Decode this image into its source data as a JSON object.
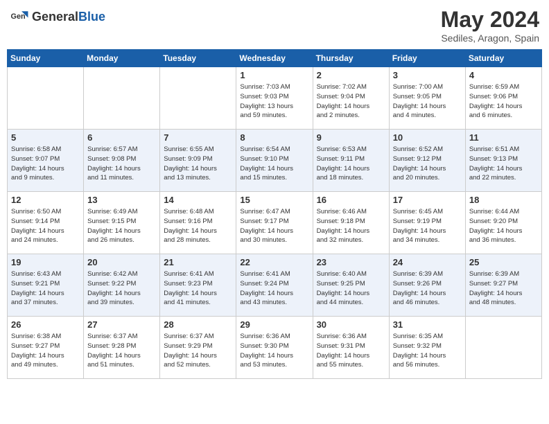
{
  "header": {
    "logo_general": "General",
    "logo_blue": "Blue",
    "month_year": "May 2024",
    "location": "Sediles, Aragon, Spain"
  },
  "days_of_week": [
    "Sunday",
    "Monday",
    "Tuesday",
    "Wednesday",
    "Thursday",
    "Friday",
    "Saturday"
  ],
  "weeks": [
    [
      {
        "day": "",
        "info": ""
      },
      {
        "day": "",
        "info": ""
      },
      {
        "day": "",
        "info": ""
      },
      {
        "day": "1",
        "info": "Sunrise: 7:03 AM\nSunset: 9:03 PM\nDaylight: 13 hours\nand 59 minutes."
      },
      {
        "day": "2",
        "info": "Sunrise: 7:02 AM\nSunset: 9:04 PM\nDaylight: 14 hours\nand 2 minutes."
      },
      {
        "day": "3",
        "info": "Sunrise: 7:00 AM\nSunset: 9:05 PM\nDaylight: 14 hours\nand 4 minutes."
      },
      {
        "day": "4",
        "info": "Sunrise: 6:59 AM\nSunset: 9:06 PM\nDaylight: 14 hours\nand 6 minutes."
      }
    ],
    [
      {
        "day": "5",
        "info": "Sunrise: 6:58 AM\nSunset: 9:07 PM\nDaylight: 14 hours\nand 9 minutes."
      },
      {
        "day": "6",
        "info": "Sunrise: 6:57 AM\nSunset: 9:08 PM\nDaylight: 14 hours\nand 11 minutes."
      },
      {
        "day": "7",
        "info": "Sunrise: 6:55 AM\nSunset: 9:09 PM\nDaylight: 14 hours\nand 13 minutes."
      },
      {
        "day": "8",
        "info": "Sunrise: 6:54 AM\nSunset: 9:10 PM\nDaylight: 14 hours\nand 15 minutes."
      },
      {
        "day": "9",
        "info": "Sunrise: 6:53 AM\nSunset: 9:11 PM\nDaylight: 14 hours\nand 18 minutes."
      },
      {
        "day": "10",
        "info": "Sunrise: 6:52 AM\nSunset: 9:12 PM\nDaylight: 14 hours\nand 20 minutes."
      },
      {
        "day": "11",
        "info": "Sunrise: 6:51 AM\nSunset: 9:13 PM\nDaylight: 14 hours\nand 22 minutes."
      }
    ],
    [
      {
        "day": "12",
        "info": "Sunrise: 6:50 AM\nSunset: 9:14 PM\nDaylight: 14 hours\nand 24 minutes."
      },
      {
        "day": "13",
        "info": "Sunrise: 6:49 AM\nSunset: 9:15 PM\nDaylight: 14 hours\nand 26 minutes."
      },
      {
        "day": "14",
        "info": "Sunrise: 6:48 AM\nSunset: 9:16 PM\nDaylight: 14 hours\nand 28 minutes."
      },
      {
        "day": "15",
        "info": "Sunrise: 6:47 AM\nSunset: 9:17 PM\nDaylight: 14 hours\nand 30 minutes."
      },
      {
        "day": "16",
        "info": "Sunrise: 6:46 AM\nSunset: 9:18 PM\nDaylight: 14 hours\nand 32 minutes."
      },
      {
        "day": "17",
        "info": "Sunrise: 6:45 AM\nSunset: 9:19 PM\nDaylight: 14 hours\nand 34 minutes."
      },
      {
        "day": "18",
        "info": "Sunrise: 6:44 AM\nSunset: 9:20 PM\nDaylight: 14 hours\nand 36 minutes."
      }
    ],
    [
      {
        "day": "19",
        "info": "Sunrise: 6:43 AM\nSunset: 9:21 PM\nDaylight: 14 hours\nand 37 minutes."
      },
      {
        "day": "20",
        "info": "Sunrise: 6:42 AM\nSunset: 9:22 PM\nDaylight: 14 hours\nand 39 minutes."
      },
      {
        "day": "21",
        "info": "Sunrise: 6:41 AM\nSunset: 9:23 PM\nDaylight: 14 hours\nand 41 minutes."
      },
      {
        "day": "22",
        "info": "Sunrise: 6:41 AM\nSunset: 9:24 PM\nDaylight: 14 hours\nand 43 minutes."
      },
      {
        "day": "23",
        "info": "Sunrise: 6:40 AM\nSunset: 9:25 PM\nDaylight: 14 hours\nand 44 minutes."
      },
      {
        "day": "24",
        "info": "Sunrise: 6:39 AM\nSunset: 9:26 PM\nDaylight: 14 hours\nand 46 minutes."
      },
      {
        "day": "25",
        "info": "Sunrise: 6:39 AM\nSunset: 9:27 PM\nDaylight: 14 hours\nand 48 minutes."
      }
    ],
    [
      {
        "day": "26",
        "info": "Sunrise: 6:38 AM\nSunset: 9:27 PM\nDaylight: 14 hours\nand 49 minutes."
      },
      {
        "day": "27",
        "info": "Sunrise: 6:37 AM\nSunset: 9:28 PM\nDaylight: 14 hours\nand 51 minutes."
      },
      {
        "day": "28",
        "info": "Sunrise: 6:37 AM\nSunset: 9:29 PM\nDaylight: 14 hours\nand 52 minutes."
      },
      {
        "day": "29",
        "info": "Sunrise: 6:36 AM\nSunset: 9:30 PM\nDaylight: 14 hours\nand 53 minutes."
      },
      {
        "day": "30",
        "info": "Sunrise: 6:36 AM\nSunset: 9:31 PM\nDaylight: 14 hours\nand 55 minutes."
      },
      {
        "day": "31",
        "info": "Sunrise: 6:35 AM\nSunset: 9:32 PM\nDaylight: 14 hours\nand 56 minutes."
      },
      {
        "day": "",
        "info": ""
      }
    ]
  ]
}
